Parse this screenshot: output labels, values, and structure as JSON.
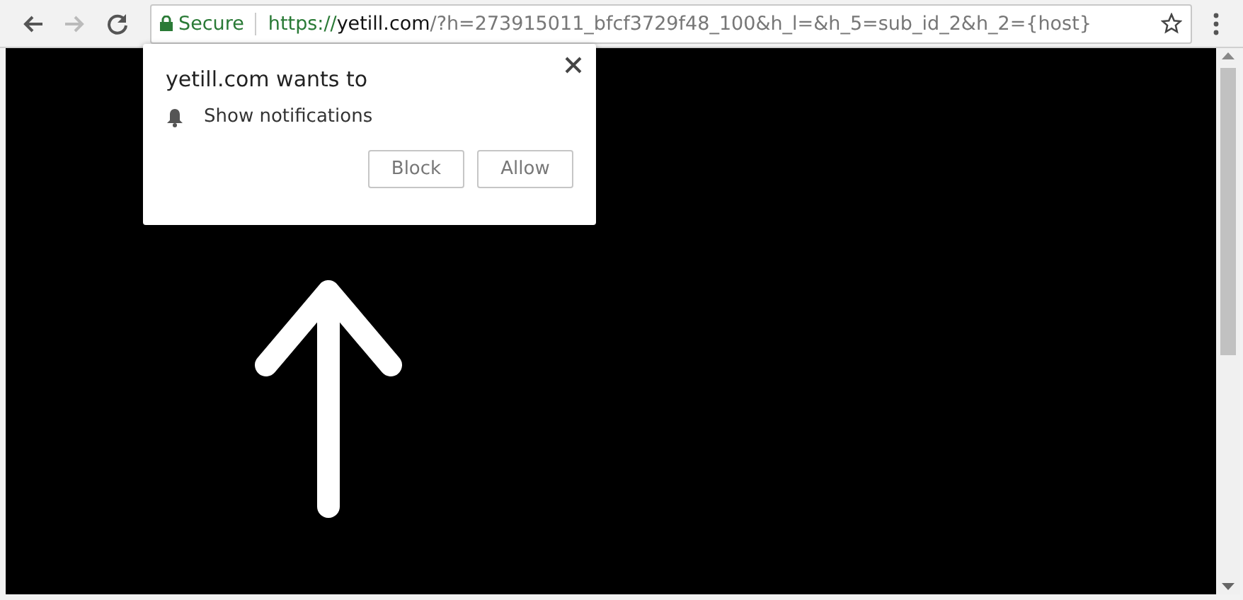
{
  "address_bar": {
    "security_label": "Secure",
    "scheme": "https://",
    "host": "yetill.com",
    "path": "/?h=273915011_bfcf3729f48_100&h_l=&h_5=sub_id_2&h_2={host}"
  },
  "permission_popup": {
    "title": "yetill.com wants to",
    "permission": "Show notifications",
    "buttons": [
      "Block",
      "Allow"
    ]
  }
}
